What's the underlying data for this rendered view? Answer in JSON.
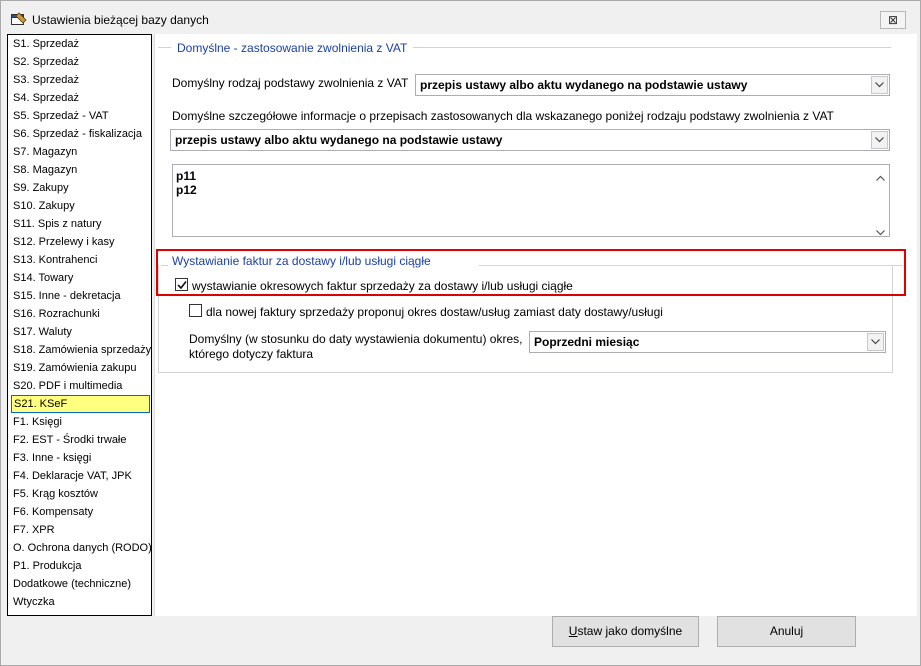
{
  "window": {
    "title": "Ustawienia bieżącej bazy danych",
    "close_label": "⊠"
  },
  "sidebar": {
    "items": [
      {
        "label": "S1. Sprzedaż"
      },
      {
        "label": "S2. Sprzedaż"
      },
      {
        "label": "S3. Sprzedaż"
      },
      {
        "label": "S4. Sprzedaż"
      },
      {
        "label": "S5. Sprzedaż - VAT"
      },
      {
        "label": "S6. Sprzedaż - fiskalizacja"
      },
      {
        "label": "S7. Magazyn"
      },
      {
        "label": "S8. Magazyn"
      },
      {
        "label": "S9. Zakupy"
      },
      {
        "label": "S10. Zakupy"
      },
      {
        "label": "S11. Spis z natury"
      },
      {
        "label": "S12. Przelewy i kasy"
      },
      {
        "label": "S13. Kontrahenci"
      },
      {
        "label": "S14. Towary"
      },
      {
        "label": "S15. Inne - dekretacja"
      },
      {
        "label": "S16. Rozrachunki"
      },
      {
        "label": "S17. Waluty"
      },
      {
        "label": "S18. Zamówienia sprzedaży"
      },
      {
        "label": "S19. Zamówienia zakupu"
      },
      {
        "label": "S20. PDF i multimedia"
      },
      {
        "label": "S21. KSeF"
      },
      {
        "label": "F1. Księgi"
      },
      {
        "label": "F2. EST - Środki trwałe"
      },
      {
        "label": "F3. Inne - księgi"
      },
      {
        "label": "F4. Deklaracje VAT, JPK"
      },
      {
        "label": "F5. Krąg kosztów"
      },
      {
        "label": "F6. Kompensaty"
      },
      {
        "label": "F7. XPR"
      },
      {
        "label": "O. Ochrona danych (RODO)"
      },
      {
        "label": "P1. Produkcja"
      },
      {
        "label": "Dodatkowe (techniczne)"
      },
      {
        "label": "Wtyczka"
      }
    ],
    "selected_index": 20
  },
  "vat_section": {
    "title": "Domyślne - zastosowanie zwolnienia z VAT",
    "basis_label": "Domyślny rodzaj podstawy zwolnienia z VAT",
    "basis_value": "przepis ustawy albo aktu wydanego na podstawie ustawy",
    "details_label": "Domyślne szczegółowe informacje o przepisach zastosowanych dla wskazanego poniżej rodzaju podstawy zwolnienia z VAT",
    "details_value": "przepis ustawy albo aktu wydanego na podstawie ustawy",
    "text_lines": [
      "p11",
      "p12"
    ]
  },
  "invoice_section": {
    "title": "Wystawianie faktur za dostawy i/lub usługi ciągłe",
    "periodic_label": "wystawianie okresowych faktur sprzedaży za dostawy i/lub usługi ciągłe",
    "periodic_checked": true,
    "propose_label": "dla nowej faktury sprzedaży proponuj okres dostaw/usług zamiast daty dostawy/usługi",
    "propose_checked": false,
    "period_label_line1": "Domyślny (w stosunku do daty wystawienia dokumentu) okres,",
    "period_label_line2": "którego dotyczy faktura",
    "period_value": "Poprzedni miesiąc"
  },
  "footer": {
    "default_button_ul": "U",
    "default_button_rest": "staw jako domyślne",
    "cancel_label": "Anuluj"
  }
}
